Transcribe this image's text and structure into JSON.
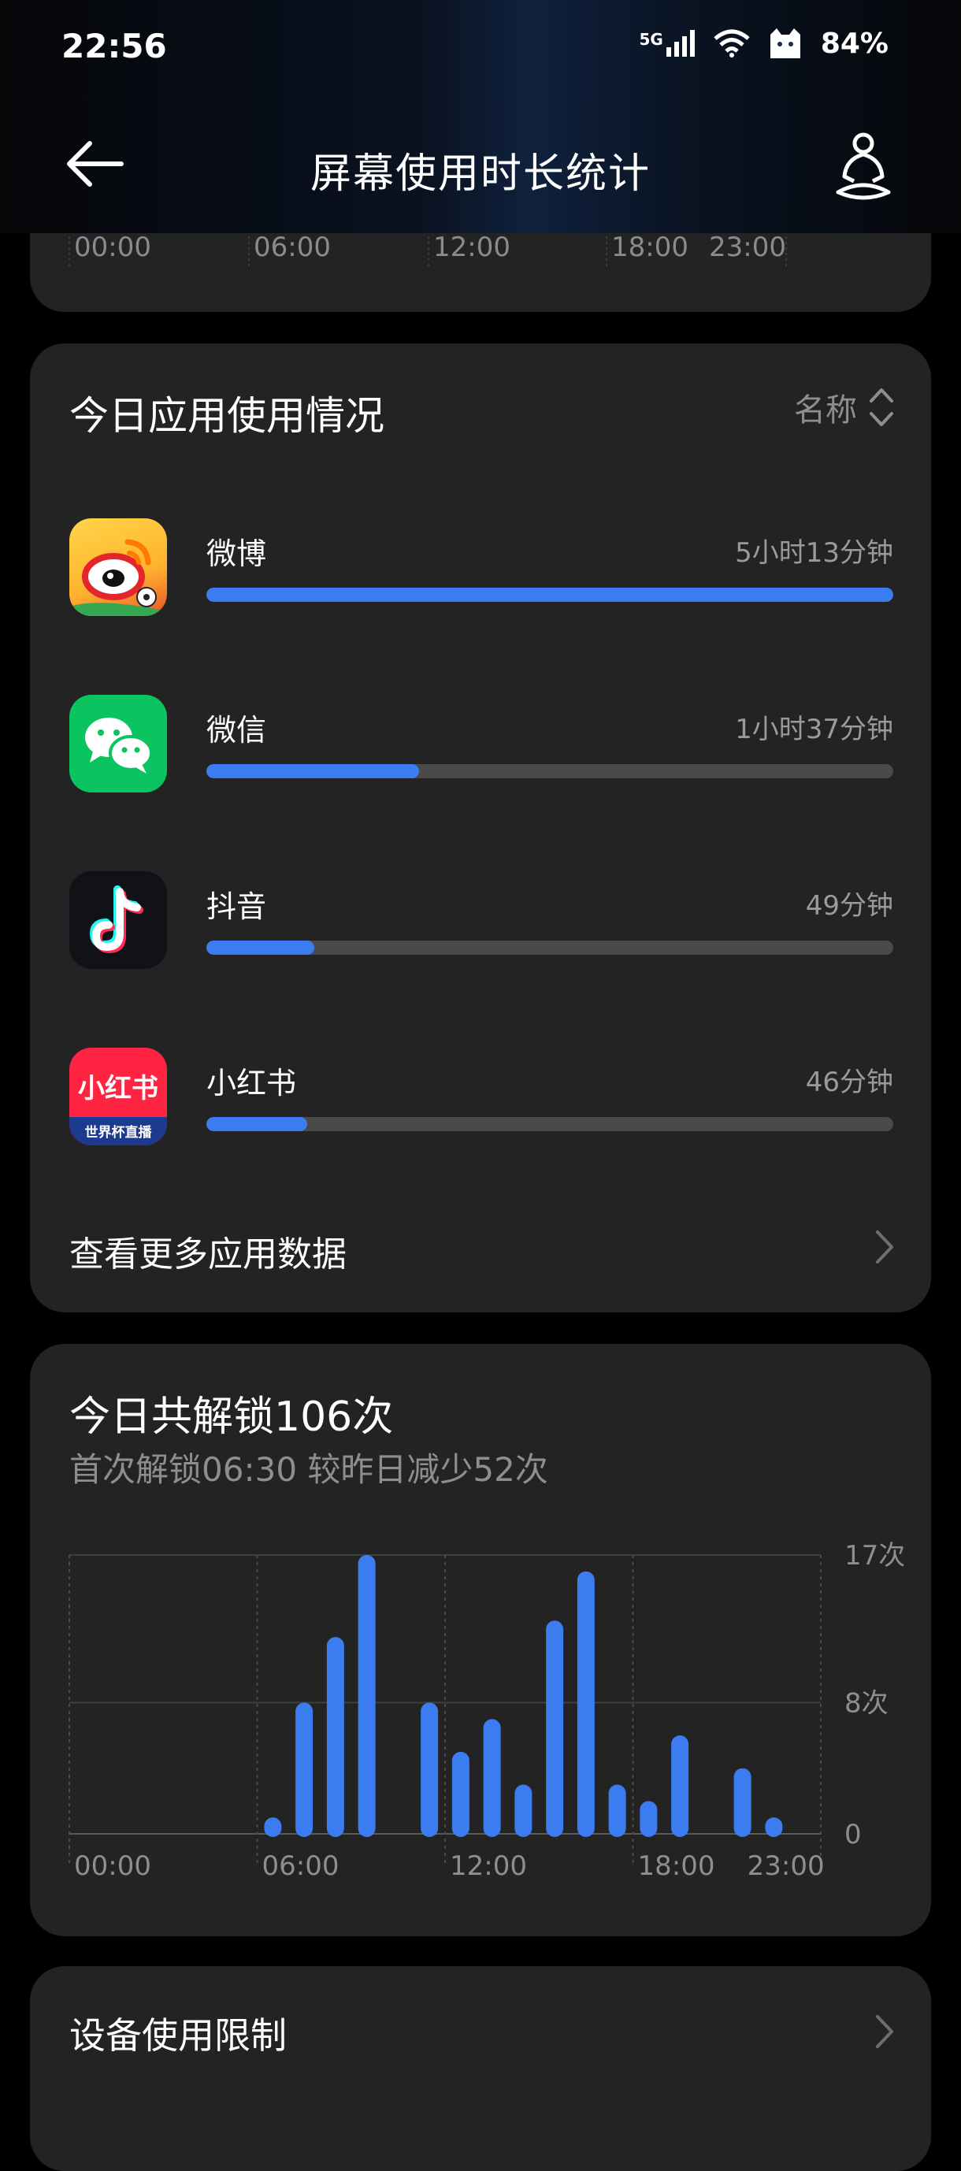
{
  "status": {
    "time": "22:56",
    "network": "5G",
    "battery": "84%"
  },
  "header": {
    "title": "屏幕使用时长统计"
  },
  "top_axis": [
    "00:00",
    "06:00",
    "12:00",
    "18:00",
    "23:00"
  ],
  "apps_card": {
    "title": "今日应用使用情况",
    "sort_label": "名称",
    "apps": [
      {
        "name": "微博",
        "time": "5小时13分钟",
        "fraction": 1.0
      },
      {
        "name": "微信",
        "time": "1小时37分钟",
        "fraction": 0.31
      },
      {
        "name": "抖音",
        "time": "49分钟",
        "fraction": 0.157
      },
      {
        "name": "小红书",
        "time": "46分钟",
        "fraction": 0.147
      }
    ],
    "xhs_badge": "世界杯直播",
    "more_label": "查看更多应用数据"
  },
  "unlock_card": {
    "title": "今日共解锁106次",
    "subtitle": "首次解锁06:30 较昨日减少52次"
  },
  "chart_data": {
    "type": "bar",
    "x_tick_labels": [
      "00:00",
      "06:00",
      "12:00",
      "18:00",
      "23:00"
    ],
    "y_tick_labels": [
      "17次",
      "8次",
      "0"
    ],
    "ylim": [
      0,
      17
    ],
    "x_hours": [
      6,
      7,
      8,
      9,
      11,
      12,
      13,
      14,
      15,
      16,
      17,
      18,
      19,
      21,
      22
    ],
    "values": [
      1,
      8,
      12,
      17,
      8,
      5,
      7,
      3,
      13,
      16,
      3,
      2,
      6,
      4,
      1
    ],
    "color": "#3b7df0",
    "grid": true
  },
  "limit_card": {
    "label": "设备使用限制"
  },
  "colors": {
    "accent": "#3b7df0",
    "card": "#232323",
    "muted": "#8e8e8e"
  }
}
